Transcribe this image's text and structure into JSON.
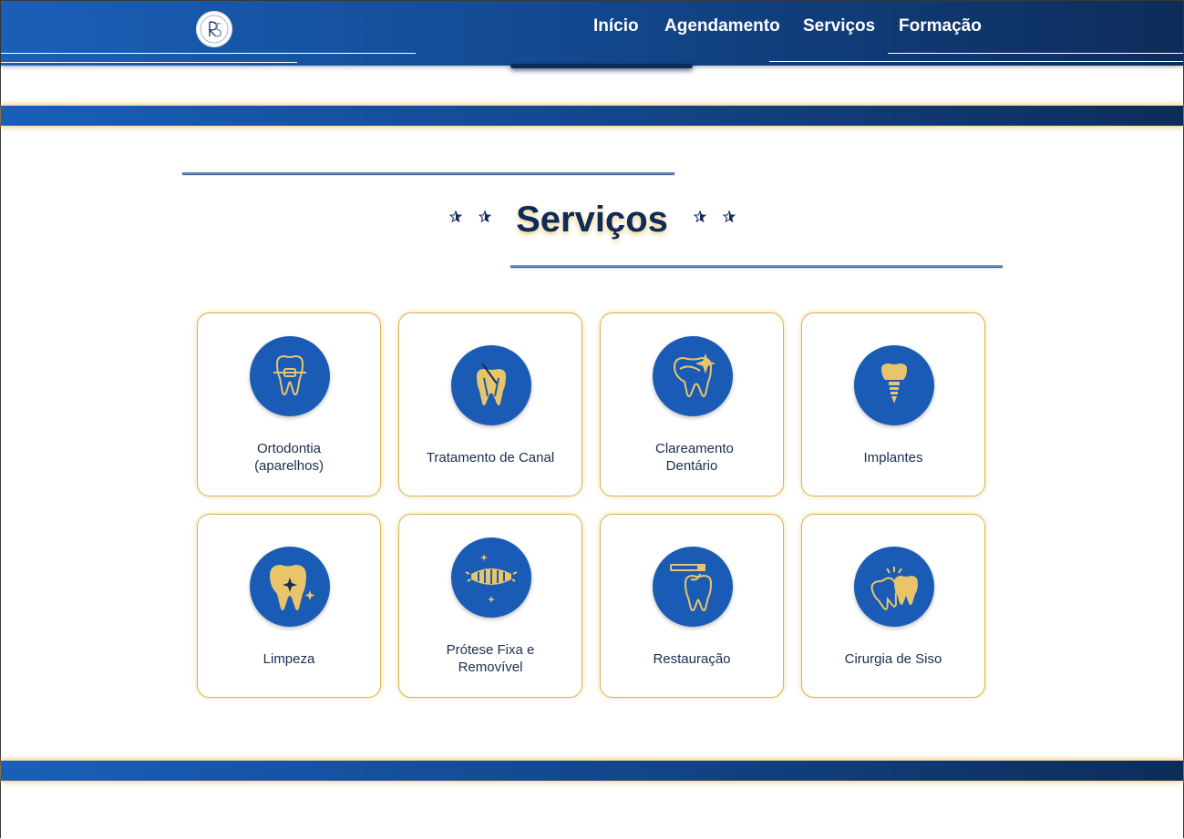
{
  "navbar": {
    "links": [
      "Início",
      "Agendamento",
      "Serviços",
      "Formação"
    ]
  },
  "section": {
    "title": "Serviços"
  },
  "services": [
    {
      "label": "Ortodontia (aparelhos)",
      "icon": "braces-tooth-icon"
    },
    {
      "label": "Tratamento de Canal",
      "icon": "root-canal-icon"
    },
    {
      "label": "Clareamento Dentário",
      "icon": "whitening-tooth-icon"
    },
    {
      "label": "Implantes",
      "icon": "implant-icon"
    },
    {
      "label": "Limpeza",
      "icon": "clean-tooth-icon"
    },
    {
      "label": "Prótese Fixa e Removível",
      "icon": "denture-icon"
    },
    {
      "label": "Restauração",
      "icon": "restoration-icon"
    },
    {
      "label": "Cirurgia de Siso",
      "icon": "wisdom-tooth-icon"
    }
  ],
  "colors": {
    "navy": "#0f2b57",
    "blue": "#1a5cb5",
    "gold": "#d9b451"
  }
}
